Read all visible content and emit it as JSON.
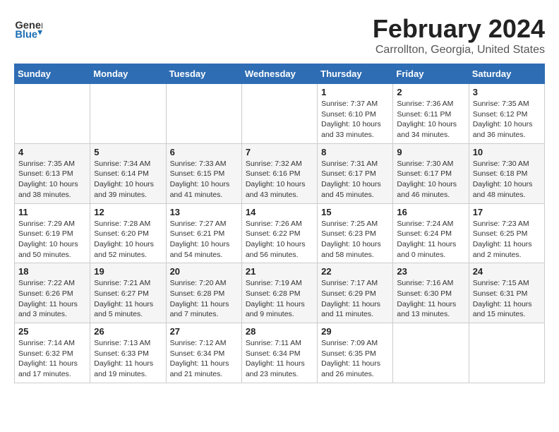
{
  "header": {
    "logo_line1": "General",
    "logo_line2": "Blue",
    "title": "February 2024",
    "subtitle": "Carrollton, Georgia, United States"
  },
  "weekdays": [
    "Sunday",
    "Monday",
    "Tuesday",
    "Wednesday",
    "Thursday",
    "Friday",
    "Saturday"
  ],
  "weeks": [
    [
      {
        "day": "",
        "info": ""
      },
      {
        "day": "",
        "info": ""
      },
      {
        "day": "",
        "info": ""
      },
      {
        "day": "",
        "info": ""
      },
      {
        "day": "1",
        "info": "Sunrise: 7:37 AM\nSunset: 6:10 PM\nDaylight: 10 hours\nand 33 minutes."
      },
      {
        "day": "2",
        "info": "Sunrise: 7:36 AM\nSunset: 6:11 PM\nDaylight: 10 hours\nand 34 minutes."
      },
      {
        "day": "3",
        "info": "Sunrise: 7:35 AM\nSunset: 6:12 PM\nDaylight: 10 hours\nand 36 minutes."
      }
    ],
    [
      {
        "day": "4",
        "info": "Sunrise: 7:35 AM\nSunset: 6:13 PM\nDaylight: 10 hours\nand 38 minutes."
      },
      {
        "day": "5",
        "info": "Sunrise: 7:34 AM\nSunset: 6:14 PM\nDaylight: 10 hours\nand 39 minutes."
      },
      {
        "day": "6",
        "info": "Sunrise: 7:33 AM\nSunset: 6:15 PM\nDaylight: 10 hours\nand 41 minutes."
      },
      {
        "day": "7",
        "info": "Sunrise: 7:32 AM\nSunset: 6:16 PM\nDaylight: 10 hours\nand 43 minutes."
      },
      {
        "day": "8",
        "info": "Sunrise: 7:31 AM\nSunset: 6:17 PM\nDaylight: 10 hours\nand 45 minutes."
      },
      {
        "day": "9",
        "info": "Sunrise: 7:30 AM\nSunset: 6:17 PM\nDaylight: 10 hours\nand 46 minutes."
      },
      {
        "day": "10",
        "info": "Sunrise: 7:30 AM\nSunset: 6:18 PM\nDaylight: 10 hours\nand 48 minutes."
      }
    ],
    [
      {
        "day": "11",
        "info": "Sunrise: 7:29 AM\nSunset: 6:19 PM\nDaylight: 10 hours\nand 50 minutes."
      },
      {
        "day": "12",
        "info": "Sunrise: 7:28 AM\nSunset: 6:20 PM\nDaylight: 10 hours\nand 52 minutes."
      },
      {
        "day": "13",
        "info": "Sunrise: 7:27 AM\nSunset: 6:21 PM\nDaylight: 10 hours\nand 54 minutes."
      },
      {
        "day": "14",
        "info": "Sunrise: 7:26 AM\nSunset: 6:22 PM\nDaylight: 10 hours\nand 56 minutes."
      },
      {
        "day": "15",
        "info": "Sunrise: 7:25 AM\nSunset: 6:23 PM\nDaylight: 10 hours\nand 58 minutes."
      },
      {
        "day": "16",
        "info": "Sunrise: 7:24 AM\nSunset: 6:24 PM\nDaylight: 11 hours\nand 0 minutes."
      },
      {
        "day": "17",
        "info": "Sunrise: 7:23 AM\nSunset: 6:25 PM\nDaylight: 11 hours\nand 2 minutes."
      }
    ],
    [
      {
        "day": "18",
        "info": "Sunrise: 7:22 AM\nSunset: 6:26 PM\nDaylight: 11 hours\nand 3 minutes."
      },
      {
        "day": "19",
        "info": "Sunrise: 7:21 AM\nSunset: 6:27 PM\nDaylight: 11 hours\nand 5 minutes."
      },
      {
        "day": "20",
        "info": "Sunrise: 7:20 AM\nSunset: 6:28 PM\nDaylight: 11 hours\nand 7 minutes."
      },
      {
        "day": "21",
        "info": "Sunrise: 7:19 AM\nSunset: 6:28 PM\nDaylight: 11 hours\nand 9 minutes."
      },
      {
        "day": "22",
        "info": "Sunrise: 7:17 AM\nSunset: 6:29 PM\nDaylight: 11 hours\nand 11 minutes."
      },
      {
        "day": "23",
        "info": "Sunrise: 7:16 AM\nSunset: 6:30 PM\nDaylight: 11 hours\nand 13 minutes."
      },
      {
        "day": "24",
        "info": "Sunrise: 7:15 AM\nSunset: 6:31 PM\nDaylight: 11 hours\nand 15 minutes."
      }
    ],
    [
      {
        "day": "25",
        "info": "Sunrise: 7:14 AM\nSunset: 6:32 PM\nDaylight: 11 hours\nand 17 minutes."
      },
      {
        "day": "26",
        "info": "Sunrise: 7:13 AM\nSunset: 6:33 PM\nDaylight: 11 hours\nand 19 minutes."
      },
      {
        "day": "27",
        "info": "Sunrise: 7:12 AM\nSunset: 6:34 PM\nDaylight: 11 hours\nand 21 minutes."
      },
      {
        "day": "28",
        "info": "Sunrise: 7:11 AM\nSunset: 6:34 PM\nDaylight: 11 hours\nand 23 minutes."
      },
      {
        "day": "29",
        "info": "Sunrise: 7:09 AM\nSunset: 6:35 PM\nDaylight: 11 hours\nand 26 minutes."
      },
      {
        "day": "",
        "info": ""
      },
      {
        "day": "",
        "info": ""
      }
    ]
  ]
}
